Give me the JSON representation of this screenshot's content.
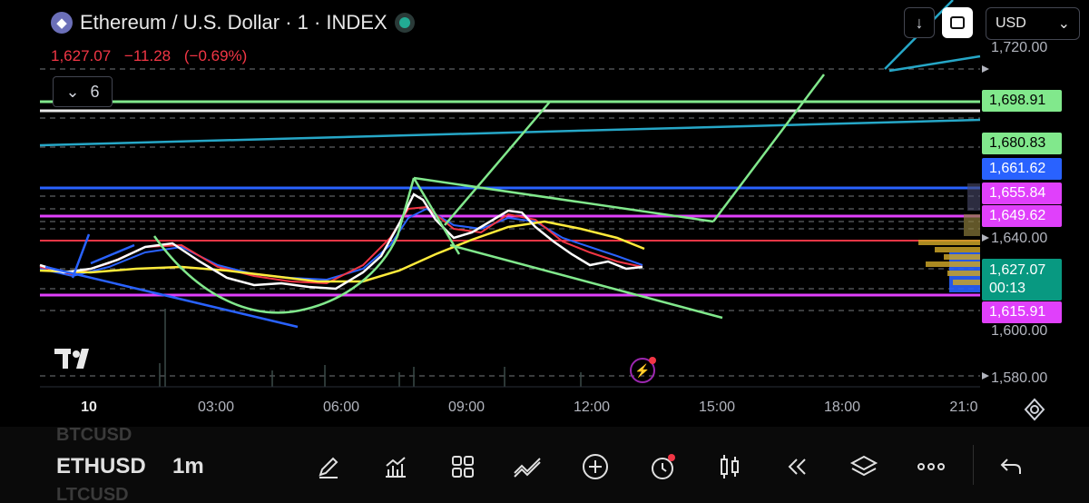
{
  "header": {
    "title": "Ethereum / U.S. Dollar · 1 · INDEX",
    "coin_glyph": "◆",
    "price": "1,627.07",
    "change": "−11.28",
    "change_pct": "(−0.69%)",
    "indicators_count": "6"
  },
  "top_controls": {
    "down_arrow": "↓",
    "currency": "USD",
    "currency_chevron": "⌄"
  },
  "price_axis": {
    "labels": [
      "1,720.00",
      "1,640.00",
      "1,600.00",
      "1,580.00"
    ],
    "tags": [
      {
        "value": "1,698.91",
        "bg": "#81e88c",
        "fg": "#000000"
      },
      {
        "value": "1,680.83",
        "bg": "#81e88c",
        "fg": "#000000"
      },
      {
        "value": "1,661.62",
        "bg": "#2962ff",
        "fg": "#ffffff"
      },
      {
        "value": "1,655.84",
        "bg": "#e040fb",
        "fg": "#ffffff"
      },
      {
        "value": "1,649.62",
        "bg": "#e040fb",
        "fg": "#ffffff"
      },
      {
        "value": "1,615.91",
        "bg": "#e040fb",
        "fg": "#ffffff"
      }
    ],
    "current": {
      "value": "1,627.07",
      "countdown": "00:13",
      "bg": "#089981",
      "fg": "#ffffff"
    }
  },
  "time_axis": {
    "labels": [
      "10",
      "03:00",
      "06:00",
      "09:00",
      "12:00",
      "15:00",
      "18:00",
      "21:0"
    ]
  },
  "chart_data": {
    "type": "line",
    "symbol": "ETHUSD",
    "interval": "1m",
    "y_axis_ticks": [
      1720,
      1640,
      1600,
      1580
    ],
    "x_axis_ticks": [
      "10",
      "03:00",
      "06:00",
      "09:00",
      "12:00",
      "15:00",
      "18:00",
      "21:0"
    ],
    "horizontal_levels": [
      {
        "price": 1698.91,
        "color": "#81e88c"
      },
      {
        "price": 1680.83,
        "color": "#81e88c"
      },
      {
        "price": 1661.62,
        "color": "#2962ff"
      },
      {
        "price": 1655.84,
        "color": "#e040fb"
      },
      {
        "price": 1649.62,
        "color": "#e040fb"
      },
      {
        "price": 1615.91,
        "color": "#e040fb"
      },
      {
        "price": 1640,
        "color": "#f23645"
      }
    ],
    "last_price": 1627.07,
    "change": -11.28,
    "change_pct": -0.69,
    "colors": {
      "up": "#089981",
      "down": "#f23645",
      "ma_white": "#ffffff",
      "ma_yellow": "#ffeb3b",
      "ma_red": "#f23645",
      "ma_blue": "#2962ff",
      "trendline_green": "#81e88c",
      "trendline_cyan": "#26a7c7"
    }
  },
  "toolbar": {
    "ticker_prev": "BTCUSD",
    "ticker": "ETHUSD",
    "ticker_next": "LTCUSD",
    "interval": "1m",
    "tools": [
      "draw-icon",
      "indicators-icon",
      "apps-icon",
      "trend-icon",
      "add-icon",
      "alert-icon",
      "candles-icon",
      "replay-icon",
      "layers-icon",
      "more-icon",
      "undo-icon"
    ]
  }
}
